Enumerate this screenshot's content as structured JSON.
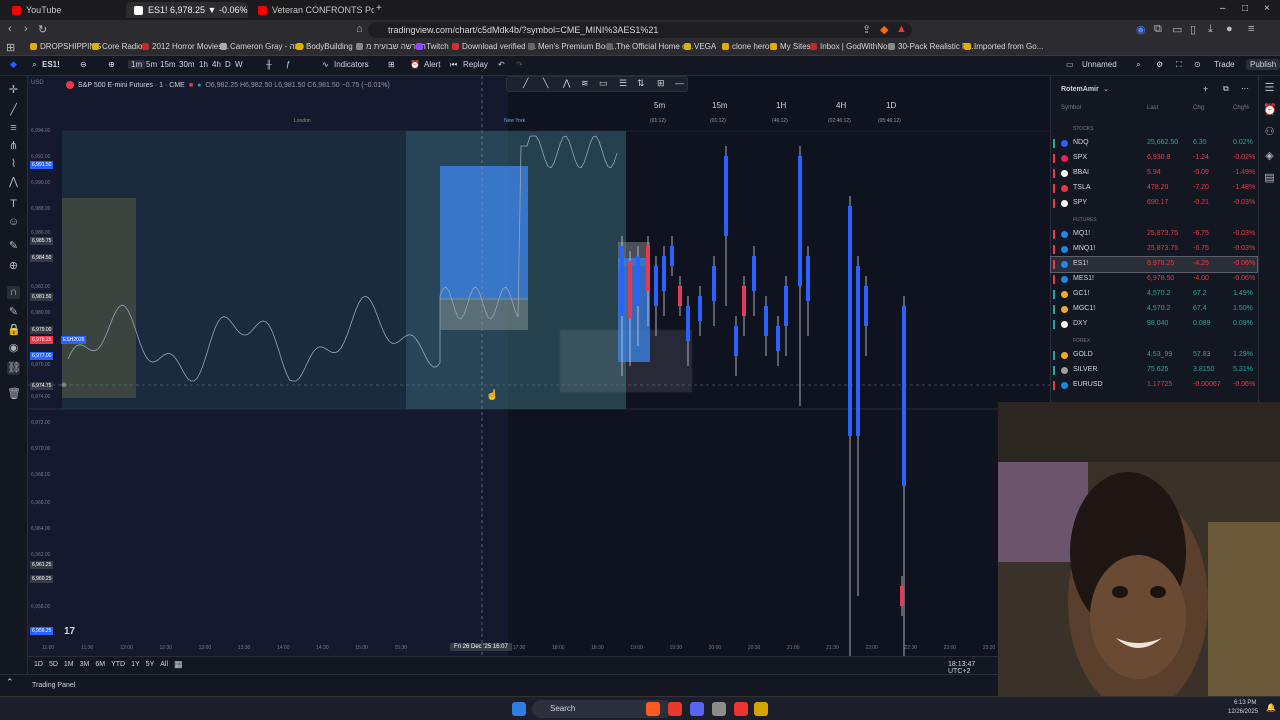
{
  "browser": {
    "tabs": [
      {
        "label": "YouTube",
        "active": false,
        "color": "#ff0000"
      },
      {
        "label": "ES1! 6,978.25 ▼ -0.06% Unnam",
        "active": true,
        "color": "#ffffff"
      },
      {
        "label": "Veteran CONFRONTS Porch Pirates",
        "active": false,
        "color": "#ff0000"
      }
    ],
    "url": "tradingview.com/chart/c5dMdk4b/?symbol=CME_MINI%3AES1%21",
    "bookmarks": [
      "DROPSHIPPING",
      "Core Radio!",
      "2012 Horror Movies...",
      "Cameron Gray - פיזה",
      "BodyBuilding",
      "הפרשה שבועית מ",
      "Twitch",
      "Download verified i...",
      "Men's Premium Bod...",
      "The Official Home o...",
      "VEGA",
      "clone hero",
      "My Sites",
      "Inbox | GodWithNo...",
      "30-Pack Realistic Fa...",
      "Imported from Go..."
    ]
  },
  "toolbar": {
    "symbol": "ES1!",
    "timeframes": [
      "1m",
      "5m",
      "15m",
      "30m",
      "1h",
      "4h",
      "D",
      "W"
    ],
    "indicators_label": "Indicators",
    "alert_label": "Alert",
    "replay_label": "Replay",
    "layout_name": "Unnamed",
    "trade_label": "Trade",
    "publish_label": "Publish"
  },
  "chart": {
    "title": "S&P 500 E-mini Futures · 1 · CME",
    "ohlc": "O6,982.25 H6,982.50 L6,981.50 C6,981.50 −0.75 (−0.01%)",
    "session_labels": [
      "London",
      "New York"
    ],
    "timeframe_buttons": [
      {
        "label": "5m",
        "sub": "(01:12)"
      },
      {
        "label": "15m",
        "sub": "(01:12)"
      },
      {
        "label": "1H",
        "sub": "(46:12)"
      },
      {
        "label": "4H",
        "sub": "(02:46:12)"
      },
      {
        "label": "1D",
        "sub": "(05:46:12)"
      }
    ],
    "price_labels": [
      "6,994.00",
      "6,992.00",
      "6,990.00",
      "6,988.00",
      "6,986.00",
      "6,982.00",
      "6,980.00",
      "6,976.00",
      "6,974.00",
      "6,972.00",
      "6,970.00",
      "6,968.00",
      "6,966.00",
      "6,964.00",
      "6,962.00",
      "6,958.00"
    ],
    "price_tags": [
      {
        "label": "6,991.50",
        "color": "#2962ff"
      },
      {
        "label": "6,985.75",
        "color": "#363a45"
      },
      {
        "label": "6,984.50",
        "color": "#363a45"
      },
      {
        "label": "6,981.50",
        "color": "#363a45"
      },
      {
        "label": "6,979.00",
        "color": "#363a45"
      },
      {
        "label": "6,978.25",
        "color": "#f23645"
      },
      {
        "label": "6,977.00",
        "color": "#2962ff"
      },
      {
        "label": "6,974.75",
        "color": "#363a45"
      },
      {
        "label": "6,961.25",
        "color": "#363a45"
      },
      {
        "label": "6,960.25",
        "color": "#363a45"
      },
      {
        "label": "6,956.25",
        "color": "#2962ff"
      }
    ],
    "es_tag": "ESH2026",
    "crosshair_time": "Fri 26 Dec '25 16:07",
    "time_labels": [
      "11:00",
      "11:30",
      "12:00",
      "12:30",
      "13:00",
      "13:30",
      "14:00",
      "14:30",
      "15:00",
      "15:30",
      "17:00",
      "17:30",
      "18:00",
      "18:30",
      "19:00",
      "19:30",
      "20:00",
      "20:30",
      "21:00",
      "21:30",
      "22:00",
      "22:30",
      "23:00",
      "23:30"
    ],
    "clock": "18:13:47 UTC+2"
  },
  "bottom": {
    "ranges": [
      "1D",
      "5D",
      "1M",
      "3M",
      "6M",
      "YTD",
      "1Y",
      "5Y",
      "All"
    ],
    "panel_label": "Trading Panel"
  },
  "watchlist": {
    "title": "RotemAmir",
    "columns": [
      "Symbol",
      "Last",
      "Chg",
      "Chg%"
    ],
    "sections": [
      {
        "name": "STOCKS",
        "rows": [
          {
            "symbol": "NDQ",
            "last": "25,662.50",
            "chg": "6.35",
            "pct": "0.02%",
            "dir": "up",
            "icon": "#2962ff"
          },
          {
            "symbol": "SPX",
            "last": "6,930.8",
            "chg": "-1.24",
            "pct": "-0.02%",
            "dir": "down",
            "icon": "#e91e63"
          },
          {
            "symbol": "BBAI",
            "last": "5.94",
            "chg": "-0.09",
            "pct": "-1.49%",
            "dir": "down",
            "icon": "#ffffff"
          },
          {
            "symbol": "TSLA",
            "last": "478.20",
            "chg": "-7.20",
            "pct": "-1.48%",
            "dir": "down",
            "icon": "#e53935"
          },
          {
            "symbol": "SPY",
            "last": "690.17",
            "chg": "-0.21",
            "pct": "-0.03%",
            "dir": "down",
            "icon": "#ffffff"
          }
        ]
      },
      {
        "name": "FUTURES",
        "rows": [
          {
            "symbol": "MQ1!",
            "last": "25,873.75",
            "chg": "-6.75",
            "pct": "-0.03%",
            "dir": "down",
            "icon": "#1e88e5"
          },
          {
            "symbol": "MNQ1!",
            "last": "25,873.75",
            "chg": "-6.75",
            "pct": "-0.03%",
            "dir": "down",
            "icon": "#1e88e5"
          },
          {
            "symbol": "ES1!",
            "last": "6,978.25",
            "chg": "-4.25",
            "pct": "-0.06%",
            "dir": "down",
            "icon": "#1e88e5",
            "selected": true
          },
          {
            "symbol": "MES1!",
            "last": "6,978.50",
            "chg": "-4.00",
            "pct": "-0.06%",
            "dir": "down",
            "icon": "#1e88e5"
          },
          {
            "symbol": "GC1!",
            "last": "4,570.2",
            "chg": "67.2",
            "pct": "1.49%",
            "dir": "up",
            "icon": "#f9a825"
          },
          {
            "symbol": "MGC1!",
            "last": "4,570.2",
            "chg": "67.4",
            "pct": "1.50%",
            "dir": "up",
            "icon": "#f9a825"
          },
          {
            "symbol": "DXY",
            "last": "98.040",
            "chg": "0.089",
            "pct": "0.09%",
            "dir": "up",
            "icon": "#ffffff"
          }
        ]
      },
      {
        "name": "FOREX",
        "rows": [
          {
            "symbol": "GOLD",
            "last": "4,53_99",
            "chg": "57.83",
            "pct": "1.29%",
            "dir": "up",
            "icon": "#f9a825"
          },
          {
            "symbol": "SILVER",
            "last": "75.625",
            "chg": "3.8150",
            "pct": "5.31%",
            "dir": "up",
            "icon": "#9e9e9e"
          },
          {
            "symbol": "EURUSD",
            "last": "1.17725",
            "chg": "-0.00067",
            "pct": "-0.06%",
            "dir": "down",
            "icon": "#1e88e5"
          }
        ]
      }
    ]
  },
  "taskbar": {
    "search_label": "Search",
    "time": "6:13 PM",
    "date": "12/26/2025"
  },
  "colors": {
    "up": "#26a69a",
    "down": "#f23645",
    "accent": "#2962ff",
    "candle_up": "#2962ff",
    "candle_down": "#131722"
  }
}
